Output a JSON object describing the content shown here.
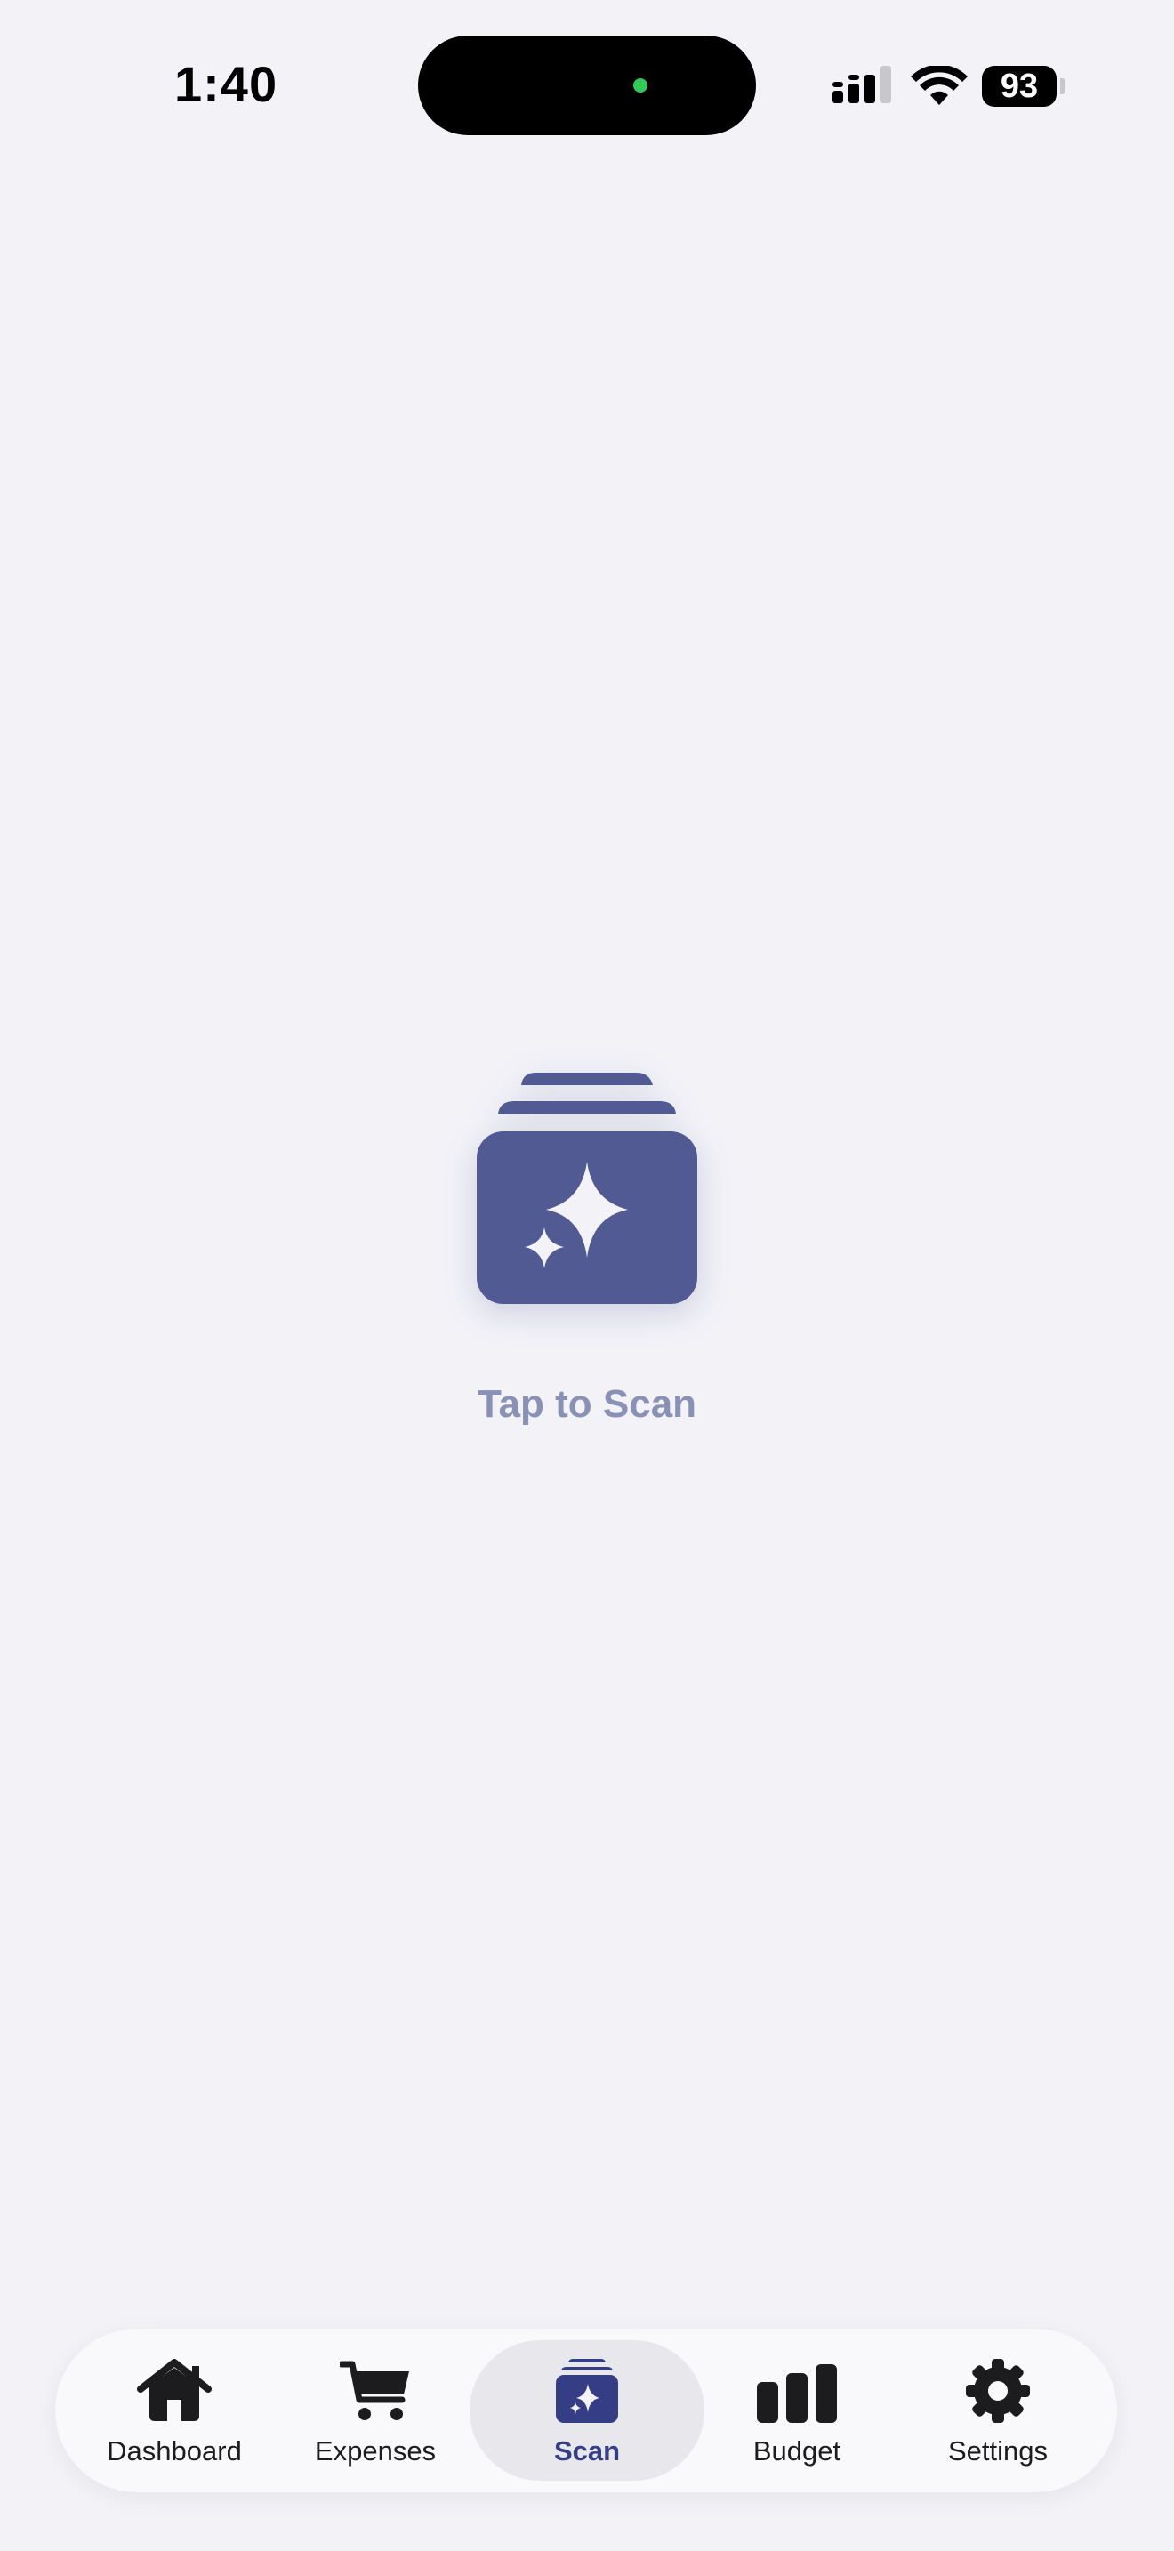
{
  "status_bar": {
    "time": "1:40",
    "battery": "93"
  },
  "scan": {
    "label": "Tap to Scan",
    "icon": "sparkle-stack-icon",
    "color": "#525a94"
  },
  "tab_bar": {
    "tabs": [
      {
        "label": "Dashboard",
        "icon": "house-icon"
      },
      {
        "label": "Expenses",
        "icon": "cart-icon"
      },
      {
        "label": "Scan",
        "icon": "sparkle-stack-icon"
      },
      {
        "label": "Budget",
        "icon": "bar-chart-icon"
      },
      {
        "label": "Settings",
        "icon": "gear-icon"
      }
    ],
    "active_index": 2,
    "active_color": "#353d85"
  }
}
